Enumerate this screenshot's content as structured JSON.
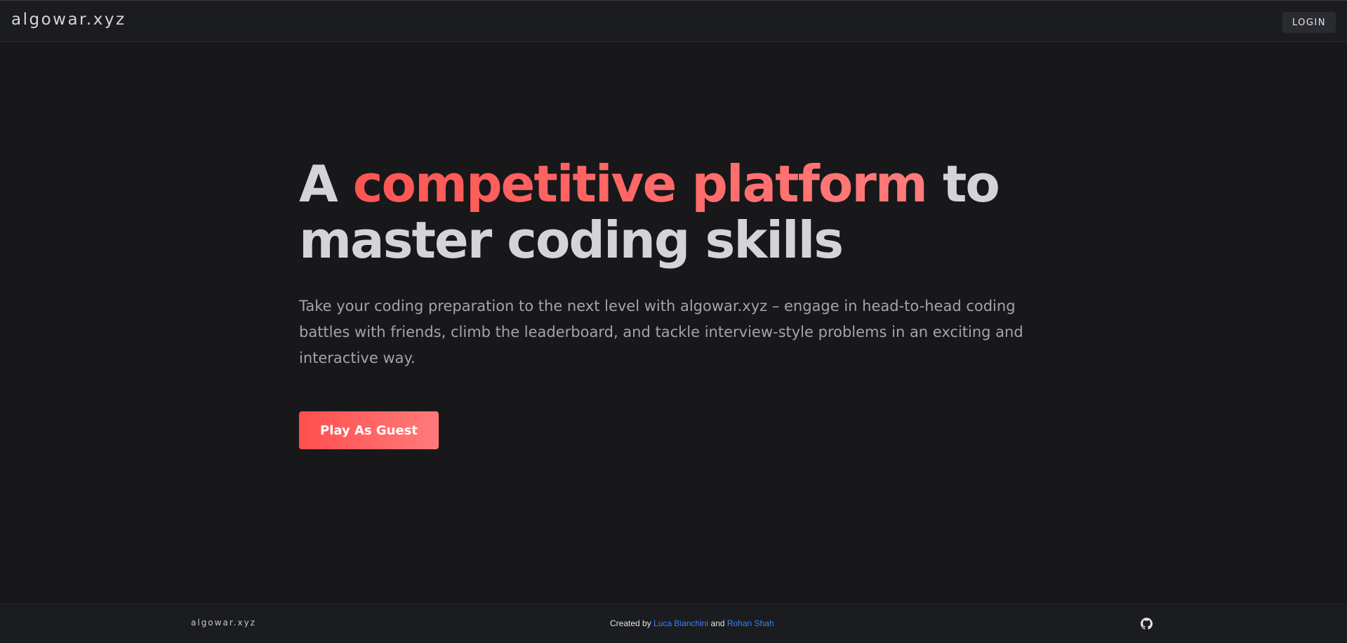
{
  "header": {
    "brand": "algowar.xyz",
    "login_label": "LOGIN"
  },
  "hero": {
    "headline_before": "A ",
    "headline_accent": "competitive platform",
    "headline_after": " to master coding skills",
    "subtitle": "Take your coding preparation to the next level with algowar.xyz – engage in head-to-head coding battles with friends, climb the leaderboard, and tackle interview-style problems in an exciting and interactive way.",
    "cta_label": "Play As Guest"
  },
  "footer": {
    "brand": "algowar.xyz",
    "credits_prefix": "Created by ",
    "author1": "Luca Bianchini",
    "credits_joiner": " and ",
    "author2": "Rohan Shah",
    "github_icon": "github-icon"
  },
  "colors": {
    "background": "#18181b",
    "bar": "#1b1c20",
    "accent": "#ff5552",
    "link": "#3b82f6"
  }
}
